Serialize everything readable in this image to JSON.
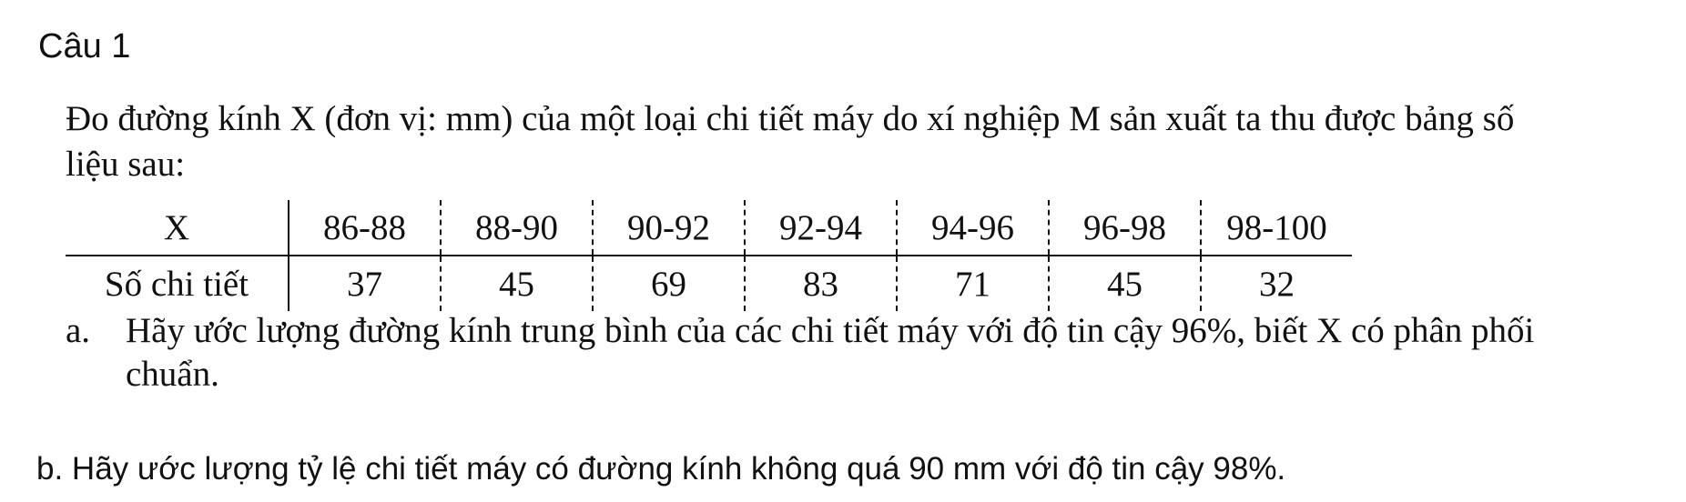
{
  "heading": "Câu 1",
  "intro": "Đo đường kính X (đơn vị: mm) của một loại chi tiết máy do xí nghiệp M sản xuất ta thu được bảng số liệu sau:",
  "table": {
    "header_label": "X",
    "row_label": "Số chi tiết",
    "intervals": [
      "86-88",
      "88-90",
      "90-92",
      "92-94",
      "94-96",
      "96-98",
      "98-100"
    ],
    "counts": [
      "37",
      "45",
      "69",
      "83",
      "71",
      "45",
      "32"
    ]
  },
  "question_a": {
    "letter": "a.",
    "text": "Hãy ước lượng đường kính trung bình của các chi tiết máy với độ tin cậy 96%, biết X có phân phối chuẩn."
  },
  "question_b": {
    "text": "b. Hãy ước lượng tỷ lệ chi tiết máy có đường kính không quá 90 mm với độ tin cậy 98%."
  }
}
